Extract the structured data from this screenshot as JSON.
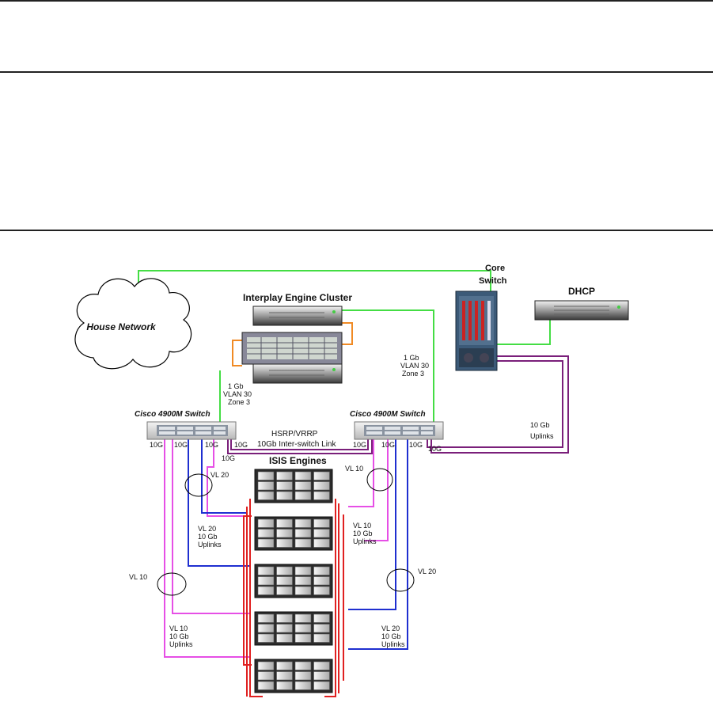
{
  "house_network": "House Network",
  "core_switch": {
    "line1": "Core",
    "line2": "Switch"
  },
  "dhcp": "DHCP",
  "interplay_cluster": "Interplay Engine Cluster",
  "link_left": {
    "l1": "1 Gb",
    "l2": "VLAN 30",
    "l3": "Zone 3"
  },
  "link_right": {
    "l1": "1 Gb",
    "l2": "VLAN 30",
    "l3": "Zone 3"
  },
  "switch_left": "Cisco 4900M Switch",
  "switch_right": "Cisco 4900M Switch",
  "hsrp": {
    "l1": "HSRP/VRRP",
    "l2": "10Gb Inter-switch Link"
  },
  "uplinks_core": {
    "l1": "10 Gb",
    "l2": "Uplinks"
  },
  "port_10g": "10G",
  "isis_engines": "ISIS Engines",
  "vl20_top_left": "VL 20",
  "vl10_top_right": "VL 10",
  "vl10_mid_left": "VL 10",
  "vl20_mid_right": "VL 20",
  "uplinks_vl20_upper": {
    "l1": "VL 20",
    "l2": "10 Gb",
    "l3": "Uplinks"
  },
  "uplinks_vl10_upper": {
    "l1": "VL 10",
    "l2": "10 Gb",
    "l3": "Uplinks"
  },
  "uplinks_vl10_lower": {
    "l1": "VL 10",
    "l2": "10 Gb",
    "l3": "Uplinks"
  },
  "uplinks_vl20_lower": {
    "l1": "VL 20",
    "l2": "10 Gb",
    "l3": "Uplinks"
  },
  "colors": {
    "green": "#44dd44",
    "orange": "#f08a24",
    "purple": "#7a1f7a",
    "magenta": "#e64fe6",
    "blue": "#1f2fd0",
    "red": "#e02020"
  }
}
